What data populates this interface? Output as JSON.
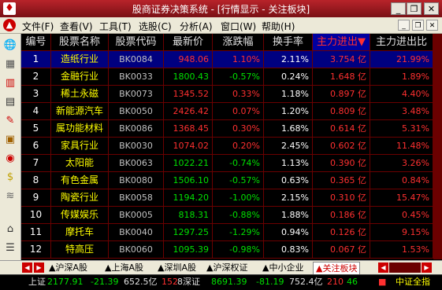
{
  "window": {
    "title": "股商证券决策系统 - [行情显示 - 关注板块]",
    "minimize": "_",
    "restore": "❐",
    "close": "✕"
  },
  "menu": {
    "items": [
      "文件(F)",
      "查看(V)",
      "工具(T)",
      "选股(C)",
      "分析(A)",
      "窗口(W)",
      "帮助(H)"
    ],
    "right_buttons": [
      "_",
      "❐",
      "✕"
    ]
  },
  "toolbar_icons": [
    "globe-icon",
    "grid-icon",
    "candlestick-icon",
    "bar-chart-icon",
    "pen-icon",
    "book-icon",
    "alert-icon",
    "dollar-icon",
    "chart-icon",
    "home-icon",
    "list-icon",
    "expand-icon"
  ],
  "table": {
    "headers": [
      "编号",
      "股票名称",
      "股票代码",
      "最新价",
      "涨跌幅",
      "换手率",
      "主力进出▼",
      "主力进出比"
    ],
    "rows": [
      {
        "no": "1",
        "name": "造纸行业",
        "code": "BK0084",
        "price": "948.06",
        "chg": "1.10%",
        "turnover": "2.11%",
        "inflow": "3.754 亿",
        "ratio": "21.99%",
        "dir": "up"
      },
      {
        "no": "2",
        "name": "金融行业",
        "code": "BK0033",
        "price": "1800.43",
        "chg": "-0.57%",
        "turnover": "0.24%",
        "inflow": "1.648 亿",
        "ratio": "1.89%",
        "dir": "down"
      },
      {
        "no": "3",
        "name": "稀土永磁",
        "code": "BK0073",
        "price": "1345.52",
        "chg": "0.33%",
        "turnover": "1.18%",
        "inflow": "0.897 亿",
        "ratio": "4.40%",
        "dir": "up"
      },
      {
        "no": "4",
        "name": "新能源汽车",
        "code": "BK0050",
        "price": "2426.42",
        "chg": "0.07%",
        "turnover": "1.20%",
        "inflow": "0.809 亿",
        "ratio": "3.48%",
        "dir": "up"
      },
      {
        "no": "5",
        "name": "属功能材料",
        "code": "BK0086",
        "price": "1368.45",
        "chg": "0.30%",
        "turnover": "1.68%",
        "inflow": "0.614 亿",
        "ratio": "5.31%",
        "dir": "up"
      },
      {
        "no": "6",
        "name": "家具行业",
        "code": "BK0030",
        "price": "1074.02",
        "chg": "0.20%",
        "turnover": "2.45%",
        "inflow": "0.602 亿",
        "ratio": "11.48%",
        "dir": "up"
      },
      {
        "no": "7",
        "name": "太阳能",
        "code": "BK0063",
        "price": "1022.21",
        "chg": "-0.74%",
        "turnover": "1.13%",
        "inflow": "0.390 亿",
        "ratio": "3.26%",
        "dir": "down"
      },
      {
        "no": "8",
        "name": "有色金属",
        "code": "BK0080",
        "price": "1506.10",
        "chg": "-0.57%",
        "turnover": "0.63%",
        "inflow": "0.365 亿",
        "ratio": "0.84%",
        "dir": "down"
      },
      {
        "no": "9",
        "name": "陶瓷行业",
        "code": "BK0058",
        "price": "1194.20",
        "chg": "-1.00%",
        "turnover": "2.15%",
        "inflow": "0.310 亿",
        "ratio": "15.47%",
        "dir": "down"
      },
      {
        "no": "10",
        "name": "传媒娱乐",
        "code": "BK0005",
        "price": "818.31",
        "chg": "-0.88%",
        "turnover": "1.88%",
        "inflow": "0.186 亿",
        "ratio": "0.45%",
        "dir": "down"
      },
      {
        "no": "11",
        "name": "摩托车",
        "code": "BK0040",
        "price": "1297.25",
        "chg": "-1.29%",
        "turnover": "0.94%",
        "inflow": "0.126 亿",
        "ratio": "9.15%",
        "dir": "down"
      },
      {
        "no": "12",
        "name": "特高压",
        "code": "BK0060",
        "price": "1095.39",
        "chg": "-0.98%",
        "turnover": "0.83%",
        "inflow": "0.067 亿",
        "ratio": "1.53%",
        "dir": "down"
      }
    ]
  },
  "tabs": [
    {
      "label": "▲沪深A股",
      "active": false
    },
    {
      "label": "▲上海A股",
      "active": false
    },
    {
      "label": "▲深圳A股",
      "active": false
    },
    {
      "label": "▲沪深权证",
      "active": false
    },
    {
      "label": "▲中小企业",
      "active": false
    },
    {
      "label": "▲关注板块",
      "active": true
    }
  ],
  "status": {
    "sh_label": "上证",
    "sh_index": "2177.91",
    "sh_chg": "-21.39",
    "sh_amt": "652.5亿",
    "sh_extra": "152",
    "sz_label": "8深证",
    "sz_index": "8691.39",
    "sz_chg": "-81.19",
    "sz_amt": "752.4亿",
    "sz_extra": "210",
    "sz_extra2": "46",
    "brand": "中证全指"
  }
}
